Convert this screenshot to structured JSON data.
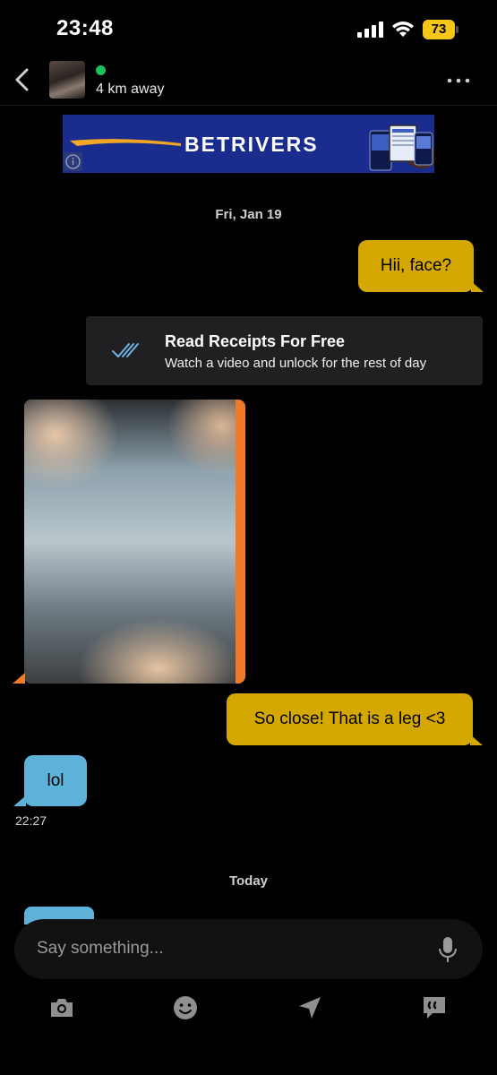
{
  "status_bar": {
    "time": "23:48",
    "battery": "73"
  },
  "header": {
    "distance": "4 km away"
  },
  "ad": {
    "brand": "BETRIVERS"
  },
  "messages": {
    "date1": "Fri, Jan 19",
    "out1": "Hii, face?",
    "receipts": {
      "title": "Read Receipts For Free",
      "subtitle": "Watch a video and unlock for the rest of day"
    },
    "out2": "So close! That is a leg <3",
    "in1": "lol",
    "in1_time": "22:27",
    "date2": "Today"
  },
  "composer": {
    "placeholder": "Say something..."
  },
  "icons": {
    "toolbar": [
      "camera-icon",
      "smiley-icon",
      "location-arrow-icon",
      "saved-phrases-icon"
    ]
  },
  "colors": {
    "outgoing_bubble": "#d4a800",
    "incoming_bubble": "#5eb1d9",
    "photo_border": "#f07a2a",
    "online": "#19c35a",
    "battery": "#f5c518"
  }
}
